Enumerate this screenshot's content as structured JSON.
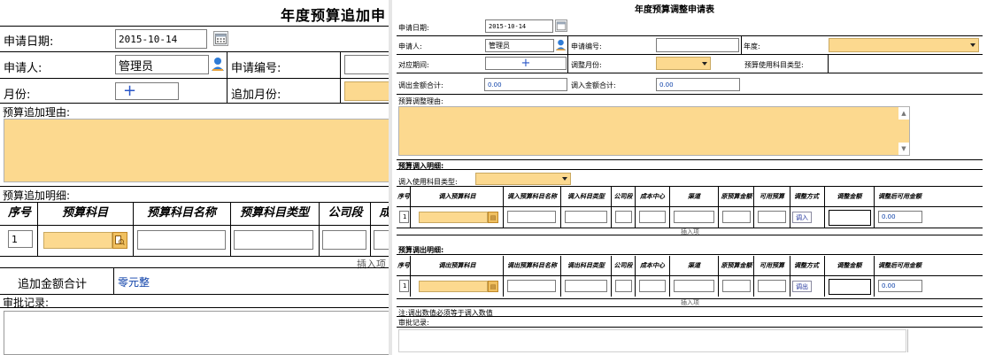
{
  "left": {
    "title": "年度预算追加申",
    "apply_date_label": "申请日期:",
    "apply_date_value": "2015-10-14",
    "applicant_label": "申请人:",
    "applicant_value": "管理员",
    "apply_no_label": "申请编号:",
    "month_label": "月份:",
    "add_month_label": "追加月份:",
    "reason_label": "预算追加理由:",
    "detail_label": "预算追加明细:",
    "columns": [
      "序号",
      "预算科目",
      "预算科目名称",
      "预算科目类型",
      "公司段",
      "成"
    ],
    "row_no": "1",
    "insert_label": "插入项",
    "total_label": "追加金额合计",
    "total_value": "零元整",
    "approval_label": "审批记录:"
  },
  "right": {
    "title": "年度预算调整申请表",
    "apply_date_label": "申请日期:",
    "apply_date_value": "2015-10-14",
    "applicant_label": "申请人:",
    "applicant_value": "管理员",
    "apply_no_label": "申请编号:",
    "year_label": "年度:",
    "period_label": "对应期间:",
    "adjust_month_label": "调整月份:",
    "subject_type_label": "预算使用科目类型:",
    "out_total_label": "调出金额合计:",
    "out_total_value": "0.00",
    "in_total_label": "调入金额合计:",
    "in_total_value": "0.00",
    "reason_label": "预算调整理由:",
    "in_section_label": "预算调入明细:",
    "in_subject_type_label": "调入使用科目类型:",
    "in_columns": [
      "序号",
      "调入预算科目",
      "调入预算科目名称",
      "调入科目类型",
      "公司段",
      "成本中心",
      "渠道",
      "原预算金额",
      "可用预算",
      "调整方式",
      "调整金额",
      "调整后可用金额"
    ],
    "out_section_label": "预算调出明细:",
    "out_columns": [
      "序号",
      "调出预算科目",
      "调出预算科目名称",
      "调出科目类型",
      "公司段",
      "成本中心",
      "渠道",
      "原预算金额",
      "可用预算",
      "调整方式",
      "调整金额",
      "调整后可用金额"
    ],
    "row_no": "1",
    "in_mode": "调入",
    "out_mode": "调出",
    "adjusted_value": "0.00",
    "insert_label": "插入项",
    "note": "注:调出数值必须等于调入数值",
    "approval_label": "审批记录:"
  },
  "colors": {
    "yellow_field": "#fcd98f",
    "blue_text": "#0b3fa8",
    "user_icon": "#2e7bd6"
  },
  "icons": [
    "calendar-icon",
    "user-icon",
    "plus-icon",
    "lookup-icon",
    "dropdown-arrow-icon",
    "scroll-arrow-icon"
  ]
}
